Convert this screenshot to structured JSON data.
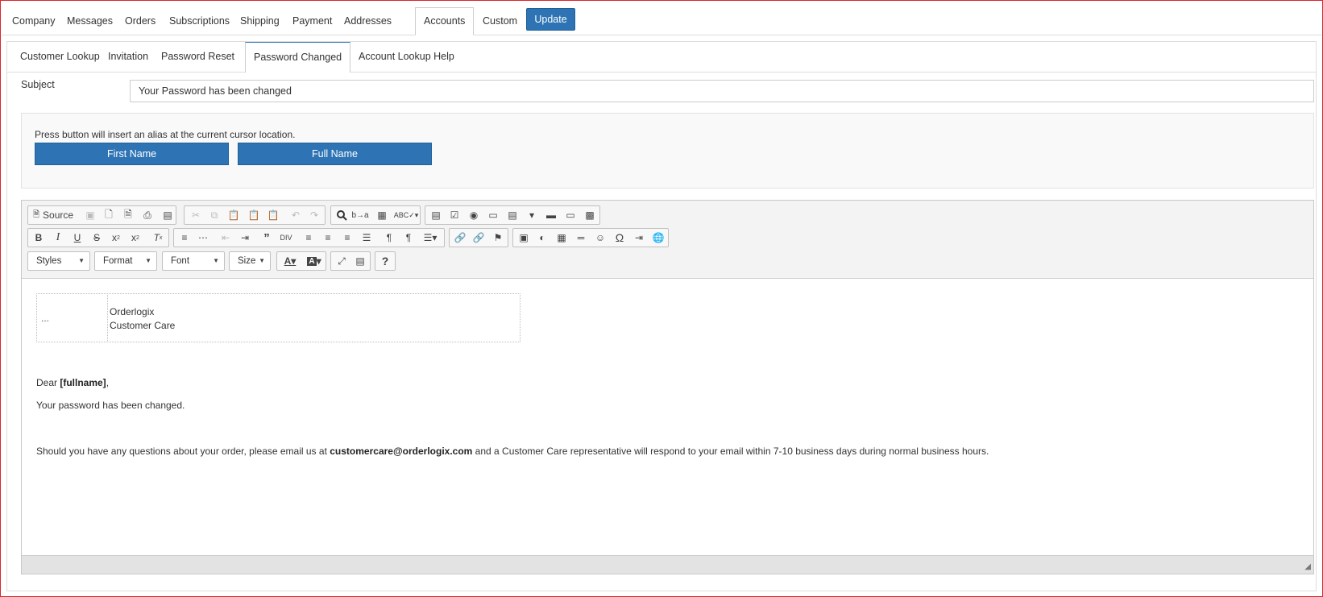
{
  "top_tabs": [
    "Company",
    "Messages",
    "Orders",
    "Subscriptions",
    "Shipping",
    "Payment",
    "Addresses",
    "Accounts",
    "Custom"
  ],
  "update_label": "Update",
  "sub_tabs": [
    "Customer Lookup",
    "Invitation",
    "Password Reset",
    "Password Changed",
    "Account Lookup Help"
  ],
  "subject": {
    "label": "Subject",
    "value": "Your Password has been changed"
  },
  "alias": {
    "hint": "Press button will insert an alias at the current cursor location.",
    "first_name": "First Name",
    "full_name": "Full Name"
  },
  "toolbar": {
    "source_label": "Source",
    "styles": "Styles",
    "format": "Format",
    "font": "Font",
    "size": "Size",
    "help": "?"
  },
  "email": {
    "sig_dots": "...",
    "sig_company": "Orderlogix",
    "sig_dept": "Customer Care",
    "dear": "Dear ",
    "fullname_alias": "[fullname]",
    "comma": ",",
    "body1": "Your password has been changed.",
    "q_before": "Should you have any questions about your order, please email us at ",
    "q_email": "customercare@orderlogix.com",
    "q_after": " and a Customer Care representative will respond to your email within 7-10 business days during normal business hours."
  },
  "colors": {
    "primary_button": "#2e74b5",
    "frame_border": "#d9262c"
  }
}
